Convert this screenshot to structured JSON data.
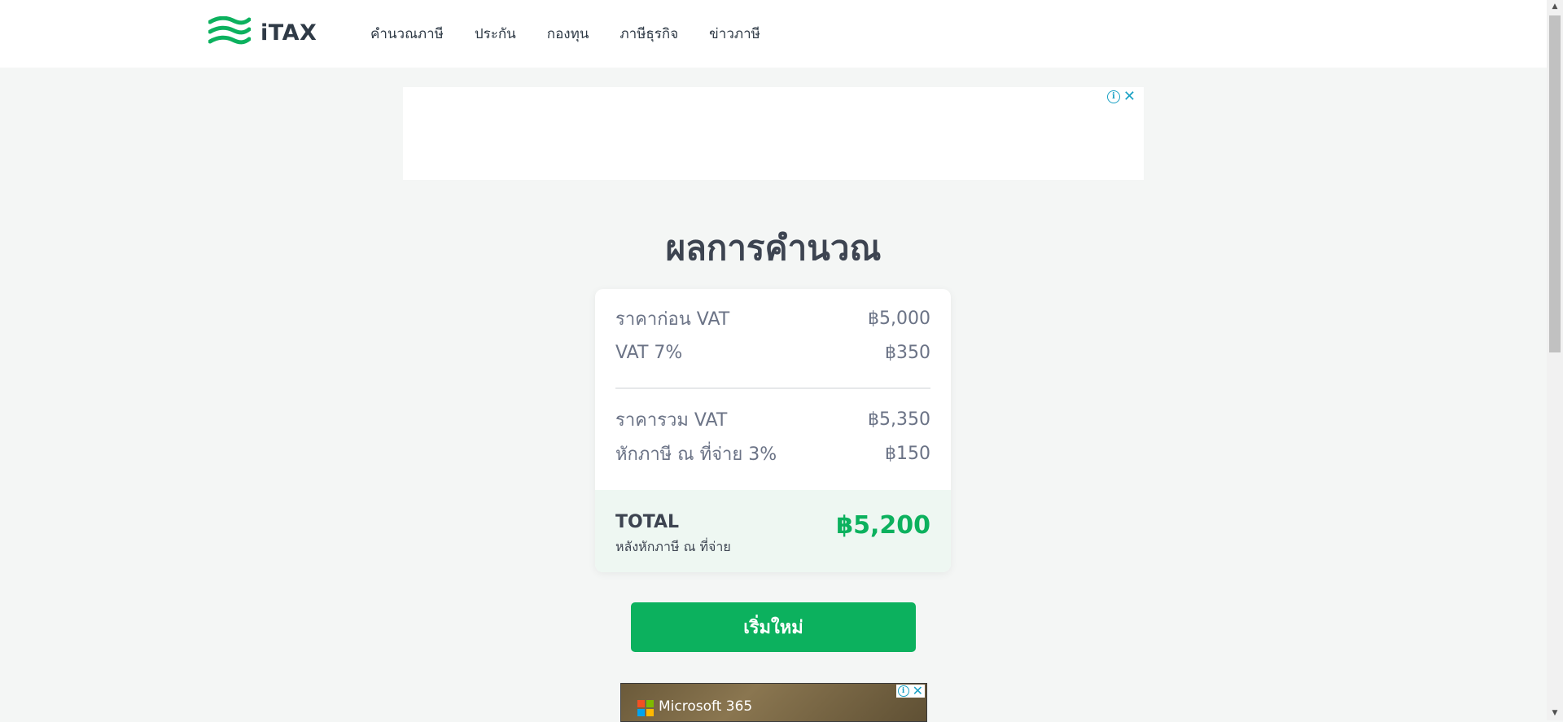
{
  "header": {
    "logo_text": "iTAX",
    "nav": [
      "คำนวณภาษี",
      "ประกัน",
      "กองทุน",
      "ภาษีธุรกิจ",
      "ข่าวภาษี"
    ]
  },
  "ad_top": {
    "info_icon": "info-icon",
    "close_icon": "close-icon",
    "close_glyph": "✕",
    "info_glyph": "i"
  },
  "result": {
    "title": "ผลการคำนวณ",
    "rows": [
      {
        "label": "ราคาก่อน VAT",
        "value": "฿5,000"
      },
      {
        "label": "VAT 7%",
        "value": "฿350"
      },
      {
        "label": "ราคารวม VAT",
        "value": "฿5,350"
      },
      {
        "label": "หักภาษี ณ ที่จ่าย 3%",
        "value": "฿150"
      }
    ],
    "total": {
      "label": "TOTAL",
      "sublabel": "หลังหักภาษี ณ ที่จ่าย",
      "value": "฿5,200"
    }
  },
  "restart_button": "เริ่มใหม่",
  "ad_bottom": {
    "brand": "Microsoft 365",
    "close_glyph": "✕",
    "info_glyph": "i"
  },
  "colors": {
    "brand_green": "#0cb15e",
    "text_dark": "#3d4451",
    "text_muted": "#6b7386",
    "background": "#f4f6f5"
  }
}
